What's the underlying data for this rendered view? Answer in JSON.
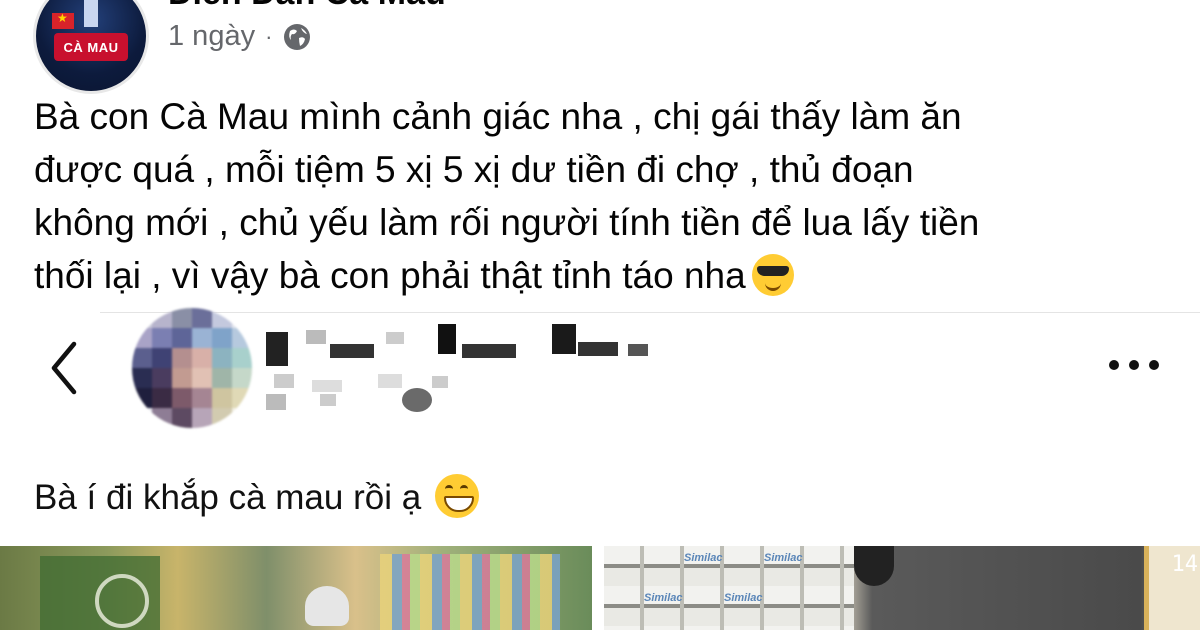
{
  "header": {
    "page_name": "Diễn Đàn Cà Mau",
    "avatar_text": "CÀ MAU",
    "time": "1 ngày",
    "separator": "·",
    "privacy_icon": "globe-icon"
  },
  "post": {
    "lines": [
      "Bà con Cà Mau mình cảnh giác nha , chị gái thấy làm ăn",
      "được quá ,  mỗi tiệm 5 xị 5 xị dư tiền đi chợ , thủ đoạn",
      "không mới , chủ yếu làm rối người tính tiền để lua lấy tiền",
      "thối lại , vì vậy bà con phải thật tỉnh táo nha"
    ],
    "emoji": "smiling-face-with-sunglasses"
  },
  "shared": {
    "back_icon": "chevron-left-icon",
    "more_icon": "more-dots-icon",
    "text": "Bà í đi khắp cà mau rồi ạ",
    "emoji": "grinning-face"
  },
  "photos": {
    "right_label": "Similac",
    "timestamp": "14"
  },
  "colors": {
    "text": "#050505",
    "meta": "#65676b",
    "divider": "#e4e4e4"
  }
}
